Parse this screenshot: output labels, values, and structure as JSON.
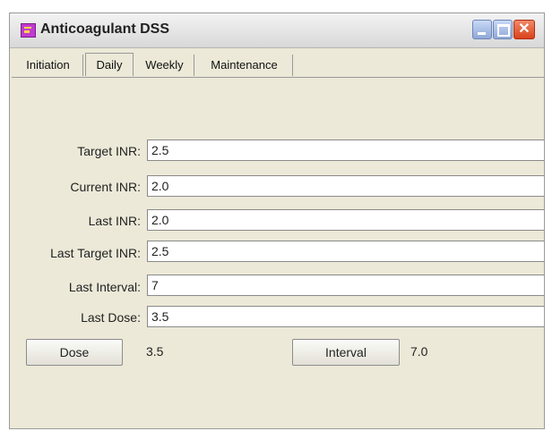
{
  "window": {
    "title": "Anticoagulant DSS",
    "close_glyph": "✕"
  },
  "tabs": [
    {
      "label": "Initiation"
    },
    {
      "label": "Daily"
    },
    {
      "label": "Weekly"
    },
    {
      "label": "Maintenance"
    }
  ],
  "active_tab": "Daily",
  "fields": [
    {
      "label": "Target INR:",
      "value": "2.5"
    },
    {
      "label": "Current INR:",
      "value": "2.0"
    },
    {
      "label": "Last INR:",
      "value": "2.0"
    },
    {
      "label": "Last Target INR:",
      "value": "2.5"
    },
    {
      "label": "Last Interval:",
      "value": "7"
    },
    {
      "label": "Last Dose:",
      "value": "3.5"
    }
  ],
  "actions": {
    "dose_label": "Dose",
    "dose_result": "3.5",
    "interval_label": "Interval",
    "interval_result": "7.0"
  },
  "icons": {
    "app": "app-icon",
    "minimize": "minimize-icon",
    "maximize": "maximize-icon",
    "close": "close-icon"
  }
}
